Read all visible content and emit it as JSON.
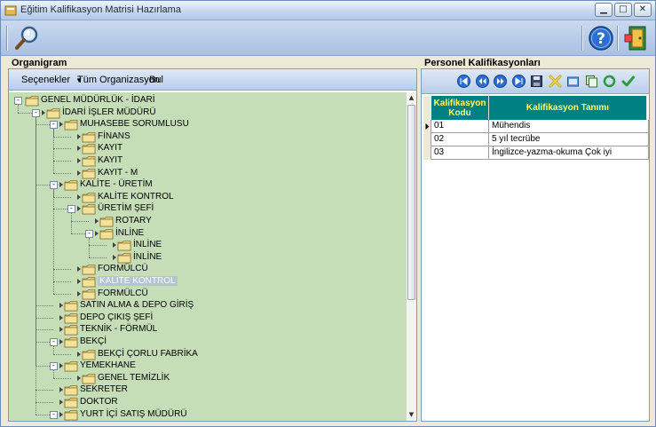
{
  "window": {
    "title": "Eğitim Kalifikasyon Matrisi Hazırlama",
    "controls": {
      "minimize": "▁",
      "maximize": "□",
      "close": "✕"
    }
  },
  "toolbar": {
    "search_icon": "magnifier-icon",
    "help_icon": "help-icon",
    "exit_icon": "exit-door-icon"
  },
  "left_panel": {
    "title": "Organigram",
    "menu": {
      "options": "Seçenekler",
      "all_org": "Tüm Organizasyon",
      "find": "Bul"
    },
    "tree": [
      {
        "label": "GENEL MÜDÜRLÜK - İDARİ",
        "depth": 0,
        "expander": "-",
        "arrow": false
      },
      {
        "label": "İDARİ İŞLER MÜDÜRÜ",
        "depth": 1,
        "expander": "-",
        "arrow": true
      },
      {
        "label": "MUHASEBE SORUMLUSU",
        "depth": 2,
        "expander": "-",
        "arrow": true
      },
      {
        "label": "FİNANS",
        "depth": 3,
        "expander": "",
        "arrow": true
      },
      {
        "label": "KAYIT",
        "depth": 3,
        "expander": "",
        "arrow": true
      },
      {
        "label": "KAYIT",
        "depth": 3,
        "expander": "",
        "arrow": true
      },
      {
        "label": "KAYIT - M",
        "depth": 3,
        "expander": "",
        "arrow": true
      },
      {
        "label": "KALİTE - ÜRETİM",
        "depth": 2,
        "expander": "-",
        "arrow": true
      },
      {
        "label": "KALİTE KONTROL",
        "depth": 3,
        "expander": "",
        "arrow": true
      },
      {
        "label": "ÜRETİM ŞEFİ",
        "depth": 3,
        "expander": "-",
        "arrow": true
      },
      {
        "label": "ROTARY",
        "depth": 4,
        "expander": "",
        "arrow": true
      },
      {
        "label": "İNLİNE",
        "depth": 4,
        "expander": "-",
        "arrow": true
      },
      {
        "label": "İNLİNE",
        "depth": 5,
        "expander": "",
        "arrow": true
      },
      {
        "label": "İNLİNE",
        "depth": 5,
        "expander": "",
        "arrow": true
      },
      {
        "label": "FORMÜLCÜ",
        "depth": 3,
        "expander": "",
        "arrow": true
      },
      {
        "label": "KALİTE KONTROL",
        "depth": 3,
        "expander": "",
        "arrow": true,
        "selected": true
      },
      {
        "label": "FORMÜLCÜ",
        "depth": 3,
        "expander": "",
        "arrow": true
      },
      {
        "label": "SATIN ALMA & DEPO GİRİŞ",
        "depth": 2,
        "expander": "",
        "arrow": true
      },
      {
        "label": "DEPO ÇIKIŞ ŞEFİ",
        "depth": 2,
        "expander": "",
        "arrow": true
      },
      {
        "label": "TEKNİK - FÖRMÜL",
        "depth": 2,
        "expander": "",
        "arrow": true
      },
      {
        "label": "BEKÇİ",
        "depth": 2,
        "expander": "-",
        "arrow": true
      },
      {
        "label": "BEKÇİ ÇORLU FABRİKA",
        "depth": 3,
        "expander": "",
        "arrow": true
      },
      {
        "label": "YEMEKHANE",
        "depth": 2,
        "expander": "-",
        "arrow": true
      },
      {
        "label": "GENEL TEMİZLİK",
        "depth": 3,
        "expander": "",
        "arrow": true
      },
      {
        "label": "SEKRETER",
        "depth": 2,
        "expander": "",
        "arrow": true
      },
      {
        "label": "DOKTOR",
        "depth": 2,
        "expander": "",
        "arrow": true
      },
      {
        "label": "YURT İÇİ SATIŞ MÜDÜRÜ",
        "depth": 2,
        "expander": "-",
        "arrow": true
      }
    ]
  },
  "right_panel": {
    "title": "Personel Kalifikasyonları",
    "nav_buttons": [
      "first-icon",
      "prior-icon",
      "next-icon",
      "last-icon",
      "save-icon",
      "delete-icon",
      "open-icon",
      "copy-icon",
      "refresh-icon",
      "confirm-icon"
    ],
    "grid": {
      "columns": [
        "Kalifikasyon Kodu",
        "Kalifikasyon Tanımı"
      ],
      "rows": [
        {
          "code": "01",
          "name": "Mühendis"
        },
        {
          "code": "02",
          "name": "5 yıl tecrübe"
        },
        {
          "code": "03",
          "name": "İngilizce-yazma-okuma Çok iyi"
        }
      ]
    }
  },
  "colors": {
    "tree_bg": "#c5deb8",
    "grid_header_bg": "#008080",
    "grid_header_text": "#ffff66",
    "toolbar_bg": "#b9cdea"
  }
}
